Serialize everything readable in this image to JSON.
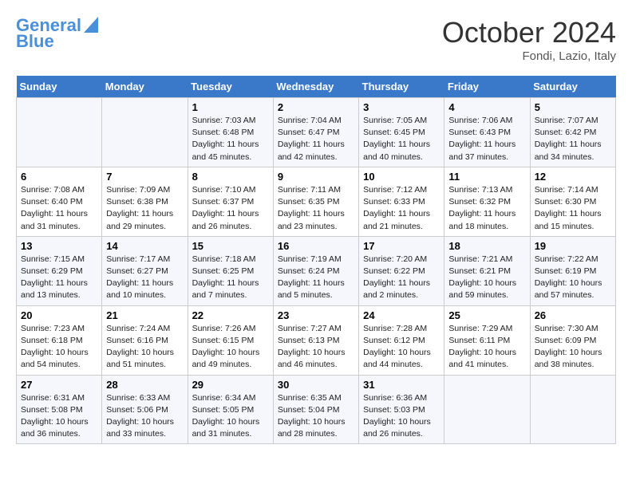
{
  "header": {
    "logo_line1": "General",
    "logo_line2": "Blue",
    "month_title": "October 2024",
    "location": "Fondi, Lazio, Italy"
  },
  "days_of_week": [
    "Sunday",
    "Monday",
    "Tuesday",
    "Wednesday",
    "Thursday",
    "Friday",
    "Saturday"
  ],
  "weeks": [
    [
      {
        "day": "",
        "info": ""
      },
      {
        "day": "",
        "info": ""
      },
      {
        "day": "1",
        "info": "Sunrise: 7:03 AM\nSunset: 6:48 PM\nDaylight: 11 hours and 45 minutes."
      },
      {
        "day": "2",
        "info": "Sunrise: 7:04 AM\nSunset: 6:47 PM\nDaylight: 11 hours and 42 minutes."
      },
      {
        "day": "3",
        "info": "Sunrise: 7:05 AM\nSunset: 6:45 PM\nDaylight: 11 hours and 40 minutes."
      },
      {
        "day": "4",
        "info": "Sunrise: 7:06 AM\nSunset: 6:43 PM\nDaylight: 11 hours and 37 minutes."
      },
      {
        "day": "5",
        "info": "Sunrise: 7:07 AM\nSunset: 6:42 PM\nDaylight: 11 hours and 34 minutes."
      }
    ],
    [
      {
        "day": "6",
        "info": "Sunrise: 7:08 AM\nSunset: 6:40 PM\nDaylight: 11 hours and 31 minutes."
      },
      {
        "day": "7",
        "info": "Sunrise: 7:09 AM\nSunset: 6:38 PM\nDaylight: 11 hours and 29 minutes."
      },
      {
        "day": "8",
        "info": "Sunrise: 7:10 AM\nSunset: 6:37 PM\nDaylight: 11 hours and 26 minutes."
      },
      {
        "day": "9",
        "info": "Sunrise: 7:11 AM\nSunset: 6:35 PM\nDaylight: 11 hours and 23 minutes."
      },
      {
        "day": "10",
        "info": "Sunrise: 7:12 AM\nSunset: 6:33 PM\nDaylight: 11 hours and 21 minutes."
      },
      {
        "day": "11",
        "info": "Sunrise: 7:13 AM\nSunset: 6:32 PM\nDaylight: 11 hours and 18 minutes."
      },
      {
        "day": "12",
        "info": "Sunrise: 7:14 AM\nSunset: 6:30 PM\nDaylight: 11 hours and 15 minutes."
      }
    ],
    [
      {
        "day": "13",
        "info": "Sunrise: 7:15 AM\nSunset: 6:29 PM\nDaylight: 11 hours and 13 minutes."
      },
      {
        "day": "14",
        "info": "Sunrise: 7:17 AM\nSunset: 6:27 PM\nDaylight: 11 hours and 10 minutes."
      },
      {
        "day": "15",
        "info": "Sunrise: 7:18 AM\nSunset: 6:25 PM\nDaylight: 11 hours and 7 minutes."
      },
      {
        "day": "16",
        "info": "Sunrise: 7:19 AM\nSunset: 6:24 PM\nDaylight: 11 hours and 5 minutes."
      },
      {
        "day": "17",
        "info": "Sunrise: 7:20 AM\nSunset: 6:22 PM\nDaylight: 11 hours and 2 minutes."
      },
      {
        "day": "18",
        "info": "Sunrise: 7:21 AM\nSunset: 6:21 PM\nDaylight: 10 hours and 59 minutes."
      },
      {
        "day": "19",
        "info": "Sunrise: 7:22 AM\nSunset: 6:19 PM\nDaylight: 10 hours and 57 minutes."
      }
    ],
    [
      {
        "day": "20",
        "info": "Sunrise: 7:23 AM\nSunset: 6:18 PM\nDaylight: 10 hours and 54 minutes."
      },
      {
        "day": "21",
        "info": "Sunrise: 7:24 AM\nSunset: 6:16 PM\nDaylight: 10 hours and 51 minutes."
      },
      {
        "day": "22",
        "info": "Sunrise: 7:26 AM\nSunset: 6:15 PM\nDaylight: 10 hours and 49 minutes."
      },
      {
        "day": "23",
        "info": "Sunrise: 7:27 AM\nSunset: 6:13 PM\nDaylight: 10 hours and 46 minutes."
      },
      {
        "day": "24",
        "info": "Sunrise: 7:28 AM\nSunset: 6:12 PM\nDaylight: 10 hours and 44 minutes."
      },
      {
        "day": "25",
        "info": "Sunrise: 7:29 AM\nSunset: 6:11 PM\nDaylight: 10 hours and 41 minutes."
      },
      {
        "day": "26",
        "info": "Sunrise: 7:30 AM\nSunset: 6:09 PM\nDaylight: 10 hours and 38 minutes."
      }
    ],
    [
      {
        "day": "27",
        "info": "Sunrise: 6:31 AM\nSunset: 5:08 PM\nDaylight: 10 hours and 36 minutes."
      },
      {
        "day": "28",
        "info": "Sunrise: 6:33 AM\nSunset: 5:06 PM\nDaylight: 10 hours and 33 minutes."
      },
      {
        "day": "29",
        "info": "Sunrise: 6:34 AM\nSunset: 5:05 PM\nDaylight: 10 hours and 31 minutes."
      },
      {
        "day": "30",
        "info": "Sunrise: 6:35 AM\nSunset: 5:04 PM\nDaylight: 10 hours and 28 minutes."
      },
      {
        "day": "31",
        "info": "Sunrise: 6:36 AM\nSunset: 5:03 PM\nDaylight: 10 hours and 26 minutes."
      },
      {
        "day": "",
        "info": ""
      },
      {
        "day": "",
        "info": ""
      }
    ]
  ]
}
